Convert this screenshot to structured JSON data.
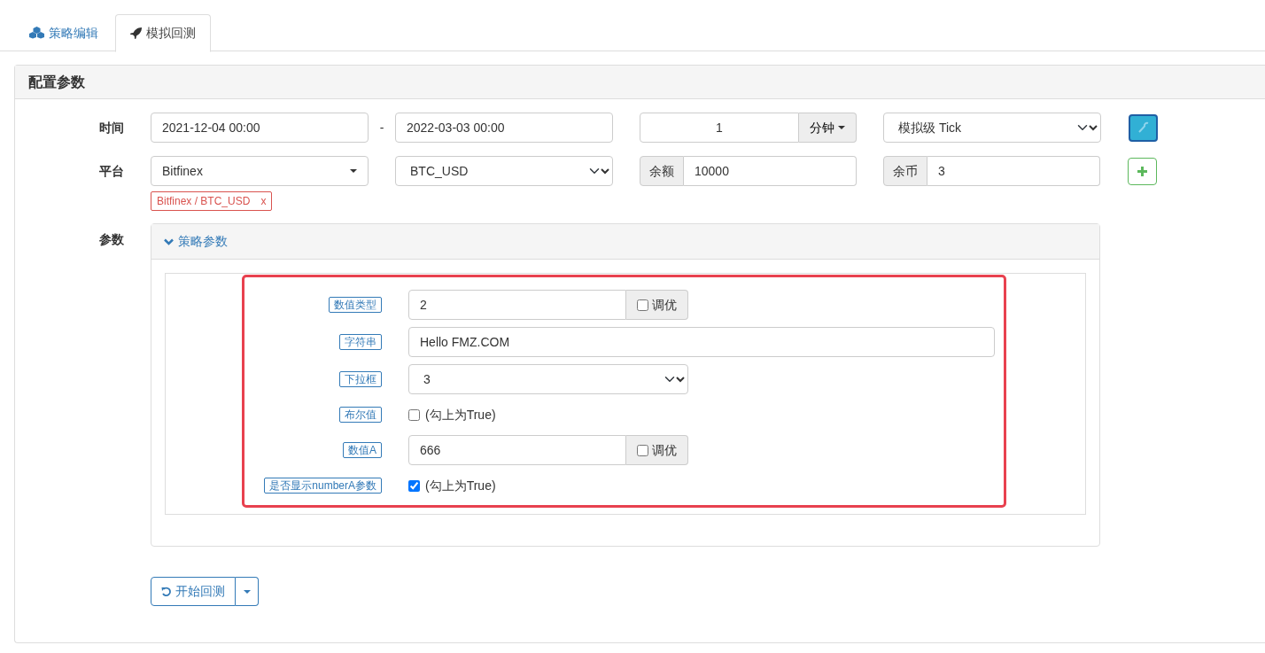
{
  "tabs": [
    {
      "label": "策略编辑",
      "kind": "cubes",
      "selected": false
    },
    {
      "label": "模拟回测",
      "kind": "rocket",
      "selected": true
    }
  ],
  "panel": {
    "title": "配置参数"
  },
  "time": {
    "label": "时间",
    "start": "2021-12-04 00:00",
    "separator": "-",
    "end": "2022-03-03 00:00",
    "period": "1",
    "unit": "分钟",
    "mode": "模拟级 Tick"
  },
  "platform": {
    "label": "平台",
    "exchange": "Bitfinex",
    "pair": "BTC_USD",
    "balance_label": "余额",
    "balance": "10000",
    "coins_label": "余币",
    "coins": "3"
  },
  "tags": [
    {
      "text": "Bitfinex / BTC_USD",
      "remove": "x"
    }
  ],
  "params": {
    "label": "参数",
    "group_title": "策略参数",
    "expanded": true,
    "items": [
      {
        "kind": "number",
        "name": "数值类型",
        "value": "2",
        "tune_label": "调优",
        "tune": false
      },
      {
        "kind": "string",
        "name": "字符串",
        "value": "Hello FMZ.COM"
      },
      {
        "kind": "select",
        "name": "下拉框",
        "value": "3"
      },
      {
        "kind": "bool",
        "name": "布尔值",
        "text": "(勾上为True)",
        "checked": false
      },
      {
        "kind": "number",
        "name": "数值A",
        "value": "666",
        "tune_label": "调优",
        "tune": false
      },
      {
        "kind": "bool",
        "name": "是否显示numberA参数",
        "text": "(勾上为True)",
        "checked": true
      }
    ]
  },
  "start_button": {
    "label": "开始回测"
  }
}
